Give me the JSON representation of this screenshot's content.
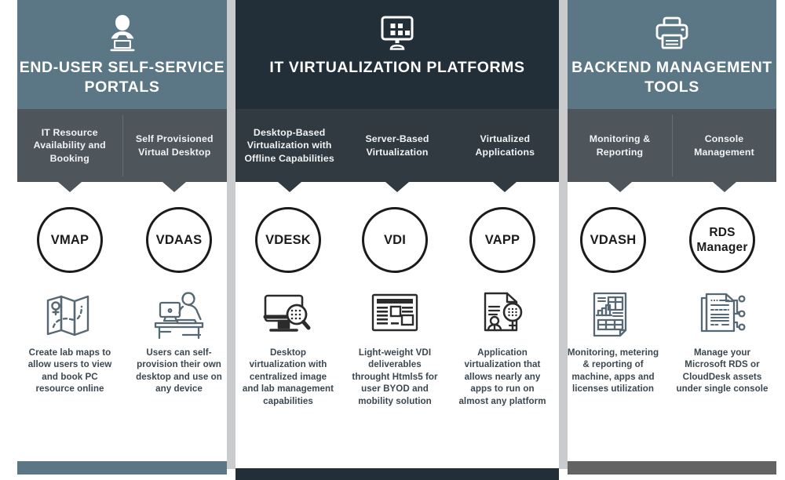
{
  "groups": [
    {
      "id": "end-user-self-service-portals",
      "title": "END-USER SELF-SERVICE PORTALS",
      "icon": "user-at-laptop-icon",
      "accent": "#5b7684",
      "sub_accent": "#4e555b",
      "foot_color": "#5b7684"
    },
    {
      "id": "it-virtualization-platforms",
      "title": "IT VIRTUALIZATION PLATFORMS",
      "icon": "monitor-tiles-icon",
      "accent": "#222f38",
      "sub_accent": "#313a41",
      "foot_color": "#222f38"
    },
    {
      "id": "backend-management-tools",
      "title": "BACKEND MANAGEMENT TOOLS",
      "icon": "printer-icon",
      "accent": "#5b7684",
      "sub_accent": "#4e555b",
      "foot_color": "#636363"
    }
  ],
  "columns": [
    {
      "id": "vmap",
      "group": 0,
      "sub_label": "IT Resource Availability and Booking",
      "badge": "VMAP",
      "icon": "folded-map-icon",
      "description": "Create lab maps to allow users to view and book PC resource online"
    },
    {
      "id": "vdaas",
      "group": 0,
      "sub_label": "Self Provisioned Virtual Desktop",
      "badge": "VDAAS",
      "icon": "person-at-desk-icon",
      "description": "Users can self-provision their own desktop and use on any device"
    },
    {
      "id": "vdesk",
      "group": 1,
      "sub_label": "Desktop-Based Virtualization with Offline Capabilities",
      "badge": "VDESK",
      "icon": "monitor-magnifier-icon",
      "description": "Desktop virtualization with centralized image and lab management capabilities"
    },
    {
      "id": "vdi",
      "group": 1,
      "sub_label": "Server-Based Virtualization",
      "badge": "VDI",
      "icon": "browser-window-icon",
      "description": "Light-weight VDI deliverables throught Htmls5 for user BYOD and mobility solution"
    },
    {
      "id": "vapp",
      "group": 1,
      "sub_label": "Virtualized Applications",
      "badge": "VAPP",
      "icon": "document-person-magnifier-icon",
      "description": "Application virtualization that allows nearly any apps to run on almost any platform"
    },
    {
      "id": "vdash",
      "group": 2,
      "sub_label": "Monitoring & Reporting",
      "badge": "VDASH",
      "icon": "report-chart-icon",
      "description": "Monitoring, metering & reporting of machine, apps and  licenses utilization"
    },
    {
      "id": "rds-manager",
      "group": 2,
      "sub_label": "Console Management",
      "badge": "RDS Manager",
      "badge_lines": [
        "RDS",
        "Manager"
      ],
      "icon": "document-network-icon",
      "description": "Manage your Microsoft RDS or CloudDesk assets under single console"
    }
  ],
  "palette": {
    "panel_teal": "#5b7684",
    "panel_dark": "#222f38",
    "subheader_gray": "#4e555b",
    "subheader_dark": "#313a41",
    "divider_gray": "#c9cbcc",
    "text_body": "#3b4750",
    "circle_stroke": "#1b1b1b",
    "icon_stroke": "#566874",
    "icon_stroke_dark": "#2b2b2b",
    "foot_right": "#636363",
    "background": "#ffffff"
  }
}
